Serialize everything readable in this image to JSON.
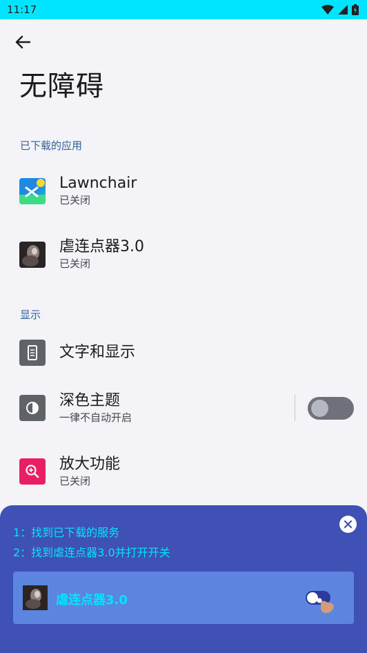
{
  "status_bar": {
    "time": "11:17"
  },
  "header": {
    "title": "无障碍"
  },
  "sections": {
    "downloaded": "已下载的应用",
    "display": "显示"
  },
  "apps": [
    {
      "title": "Lawnchair",
      "subtitle": "已关闭",
      "icon": "lawnchair-icon"
    },
    {
      "title": "虐连点器3.0",
      "subtitle": "已关闭",
      "icon": "app-thumbnail"
    }
  ],
  "display_items": [
    {
      "title": "文字和显示",
      "icon": "text-display-icon"
    },
    {
      "title": "深色主题",
      "subtitle": "一律不自动开启",
      "icon": "dark-theme-icon",
      "toggle_on": false
    },
    {
      "title": "放大功能",
      "subtitle": "已关闭",
      "icon": "magnify-icon"
    }
  ],
  "guide": {
    "step1": "1：找到已下载的服务",
    "step2": "2：找到虐连点器3.0并打开开关",
    "card_label": "虐连点器3.0"
  },
  "colors": {
    "status_bar": "#00e5ff",
    "guide_bg": "#3f51b5",
    "guide_text": "#00e5ff",
    "card_bg": "#5c85e0",
    "section_label": "#2f5f9a",
    "magnify_icon_bg": "#e91e63"
  }
}
